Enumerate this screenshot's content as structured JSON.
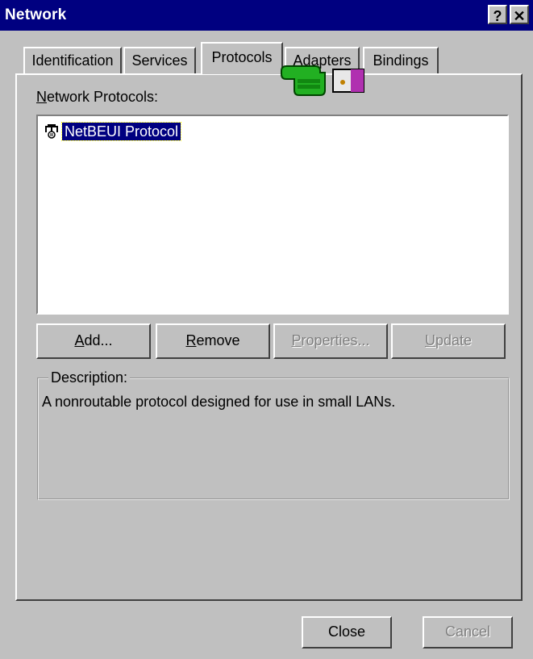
{
  "window": {
    "title": "Network",
    "help_label": "?",
    "close_label": "✕"
  },
  "tabs": [
    {
      "label": "Identification"
    },
    {
      "label": "Services"
    },
    {
      "label": "Protocols"
    },
    {
      "label": "Adapters"
    },
    {
      "label": "Bindings"
    }
  ],
  "protocols": {
    "label": "Network Protocols:",
    "items": [
      {
        "name": "NetBEUI Protocol",
        "icon": "network-protocol-icon",
        "selected": true
      }
    ]
  },
  "buttons": {
    "add": "Add...",
    "remove": "Remove",
    "properties": "Properties...",
    "update": "Update"
  },
  "description": {
    "legend": "Description:",
    "text": "A nonroutable protocol designed for use in small LANs."
  },
  "footer": {
    "close": "Close",
    "cancel": "Cancel"
  },
  "cursor": {
    "icon": "hand-pointer-icon"
  }
}
